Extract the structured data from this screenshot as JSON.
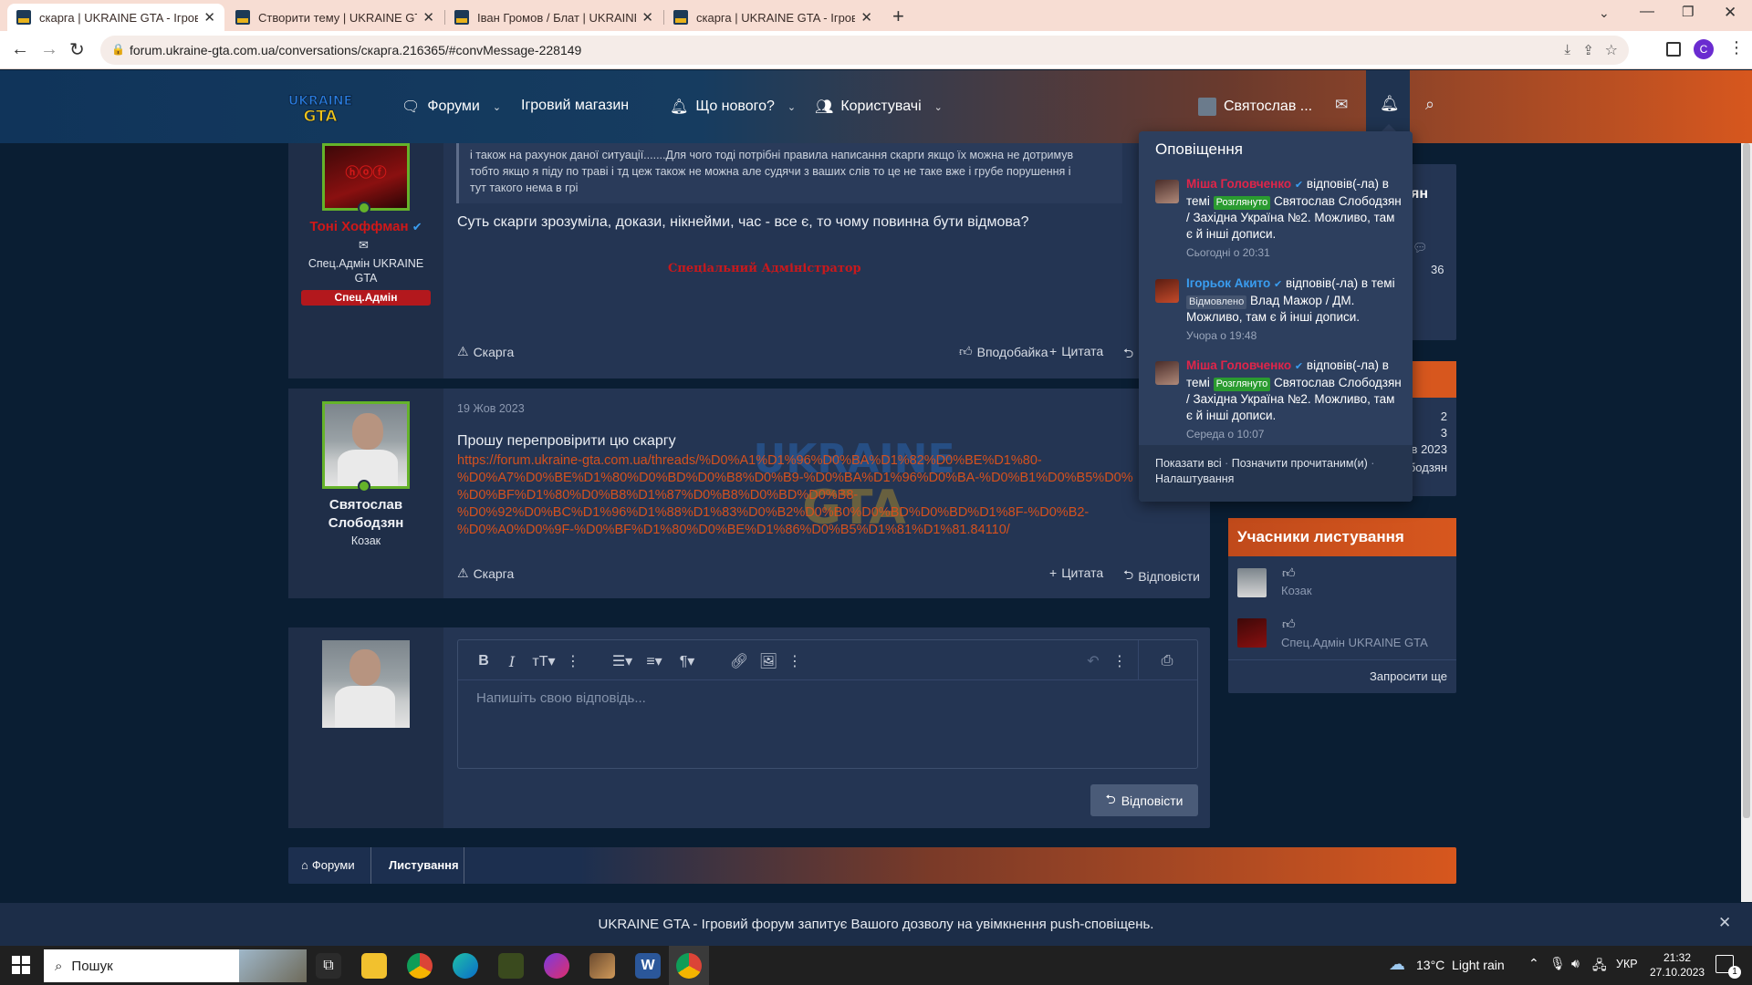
{
  "browser": {
    "tabs": [
      {
        "label": "скарга | UKRAINE GTA - Ігровий"
      },
      {
        "label": "Створити тему | UKRAINE GTA -"
      },
      {
        "label": "Іван Громов / Блат | UKRAINE G"
      },
      {
        "label": "скарга | UKRAINE GTA - Ігровий"
      }
    ],
    "url": "forum.ukraine-gta.com.ua/conversations/скарга.216365/#convMessage-228149",
    "profile_initial": "C"
  },
  "site": {
    "logo_text_top": "UKRAINE",
    "logo_text_bottom": "GTA",
    "nav": [
      {
        "label": "Форуми",
        "icon": "forum-icon",
        "dropdown": true
      },
      {
        "label": "Ігровий магазин",
        "dropdown": false
      },
      {
        "label": "Що нового?",
        "icon": "bell-icon",
        "dropdown": true
      },
      {
        "label": "Користувачі",
        "icon": "users-icon",
        "dropdown": true
      }
    ],
    "account_name": "Святослав ..."
  },
  "posts": [
    {
      "author": "Тоні Хоффман",
      "author_title": "Спец.Адмін UKRAINE GTA",
      "author_badge": "Спец.Адмін",
      "quote_lines": [
        "і також на рахунок даної ситуації.......Для чого тоді потрібні правила написання скарги якщо їх можна не дотримув",
        "тобто якщо я піду по траві і тд цеж також не можна але судячи з ваших слів то це не таке вже і грубе порушення і",
        "тут такого нема в грі"
      ],
      "text": "Суть скарги зрозуміла, докази, нікнейми, час - все є, то чому повинна бути відмова?",
      "signature": "Спеціальний Адміністратор",
      "actions": {
        "report": "Скарга",
        "like": "Вподобайка",
        "quote": "Цитата",
        "reply": "В"
      }
    },
    {
      "author": "Святослав Слободзян",
      "author_title": "Козак",
      "date": "19 Жов 2023",
      "text": "Прошу перепровірити цю скаргу",
      "link_lines": [
        "https://forum.ukraine-gta.com.ua/threads/%D0%A1%D1%96%D0%BA%D1%82%D0%BE%D1%80-",
        "%D0%A7%D0%BE%D1%80%D0%BD%D0%B8%D0%B9-%D0%BA%D1%96%D0%BA-%D0%B1%D0%B5%D0%",
        "%D0%BF%D1%80%D0%B8%D1%87%D0%B8%D0%BD%D0%B8-",
        "%D0%92%D0%BC%D1%96%D1%88%D1%83%D0%B2%D0%B0%D0%BD%D0%BD%D1%8F-%D0%B2-",
        "%D0%A0%D0%9F-%D0%BF%D1%80%D0%BE%D1%86%D0%B5%D1%81%D1%81.84110/"
      ],
      "actions": {
        "report": "Скарга",
        "quote": "Цитата",
        "reply": "Відповісти"
      }
    }
  ],
  "editor": {
    "placeholder": "Напишіть свою відповідь...",
    "submit_label": "Відповісти"
  },
  "notifications": {
    "title": "Оповіщення",
    "items": [
      {
        "user": "Міша Головченко",
        "action": "відповів(-ла)",
        "pre": "в темі",
        "tag": "Розглянуто",
        "text": "Святослав Слободзян / Західна Україна №2. Можливо, там є й інші дописи.",
        "time": "Сьогодні о 20:31"
      },
      {
        "user": "Ігорьок Акито",
        "action": "відповів(-ла) в",
        "pre": "темі",
        "tag": "Відмовлено",
        "text": "Влад Мажор / ДМ. Можливо, там є й інші дописи.",
        "time": "Учора о 19:48"
      },
      {
        "user": "Міша Головченко",
        "action": "відповів(-ла)",
        "pre": "в темі",
        "tag": "Розглянуто",
        "text": "Святослав Слободзян / Західна Україна №2. Можливо, там є й інші дописи.",
        "time": "Середа о 10:07"
      }
    ],
    "footer_show_all": "Показати всі",
    "footer_mark_read": "Позначити прочитаним(и)",
    "footer_settings": "Налаштування"
  },
  "sidebar": {
    "box1_partial_title": "ян",
    "box1_count": "36",
    "box2_values": [
      "2",
      "3",
      "в 2023",
      "бодзян"
    ],
    "participants_title": "Учасники листування",
    "participants": [
      {
        "role": "Козак"
      },
      {
        "role": "Спец.Адмін UKRAINE GTA"
      }
    ],
    "invite_more": "Запросити ще"
  },
  "breadcrumb": [
    {
      "label": "Форуми"
    },
    {
      "label": "Листування"
    }
  ],
  "push_prompt": "UKRAINE GTA - Ігровий форум запитує Вашого дозволу на увімкнення push-сповіщень.",
  "taskbar": {
    "search_placeholder": "Пошук",
    "weather": "13°C  Light rain",
    "language": "УКР",
    "time": "21:32",
    "date": "27.10.2023",
    "notification_count": "1"
  },
  "colors": {
    "accent_orange": "#d7571e",
    "header_blue": "#10345a",
    "admin_red": "#b3181d",
    "online_green": "#65b32a"
  }
}
